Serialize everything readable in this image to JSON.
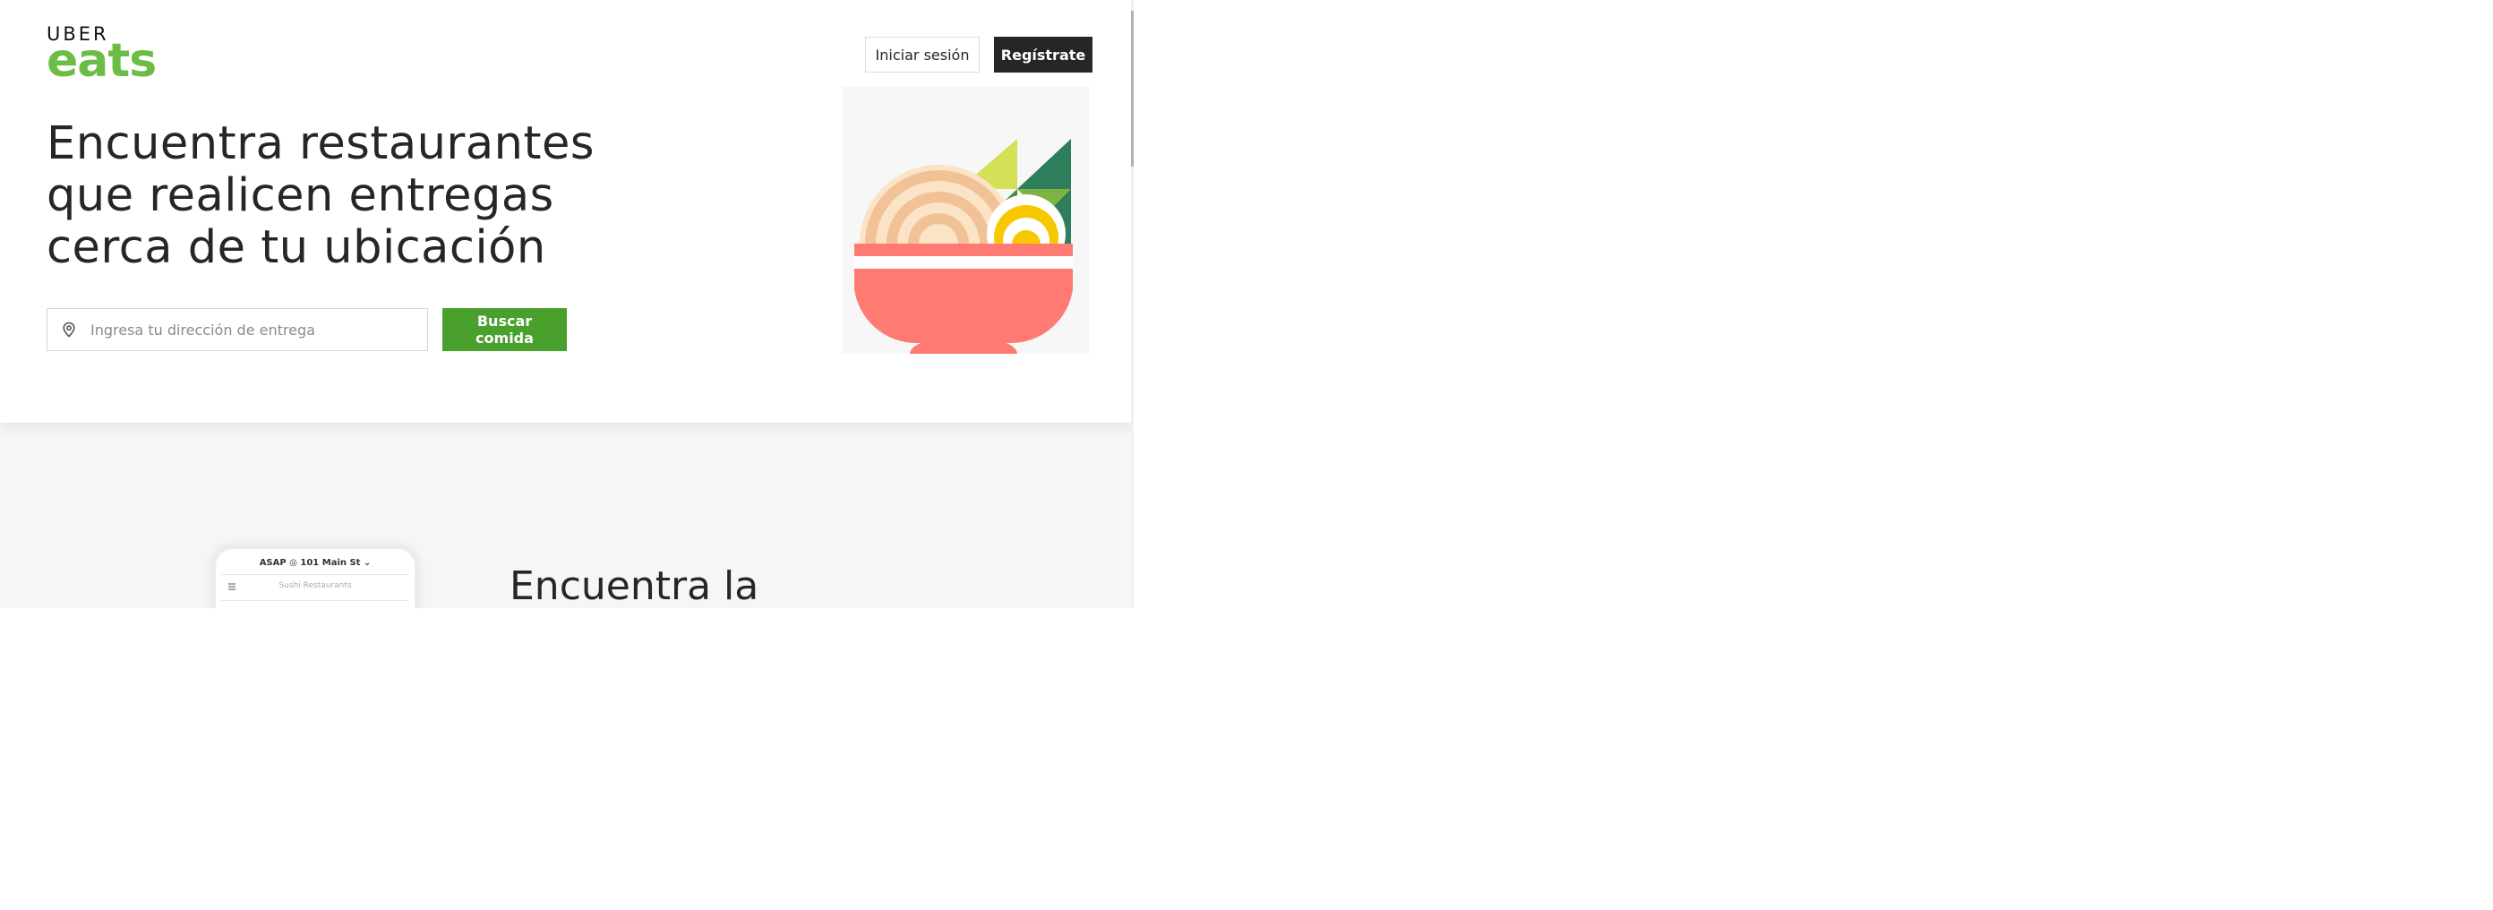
{
  "header": {
    "logo": {
      "line1": "UBER",
      "line2": "eats",
      "brand_color": "#6bbd45"
    },
    "login_label": "Iniciar sesión",
    "signup_label": "Regístrate"
  },
  "hero": {
    "headline_lines": [
      "Encuentra restaurantes",
      "que realicen entregas",
      "cerca de tu ubicación"
    ],
    "search": {
      "placeholder": "Ingresa tu dirección de entrega",
      "value": "",
      "icon": "location-pin-icon"
    },
    "find_button_label": "Buscar comida",
    "accent_color": "#4aa02c"
  },
  "section2": {
    "title": "Encuentra la",
    "phone": {
      "status_text": "ASAP ◎ 101 Main St ⌄",
      "search_placeholder": "Sushi Restaurants"
    }
  }
}
